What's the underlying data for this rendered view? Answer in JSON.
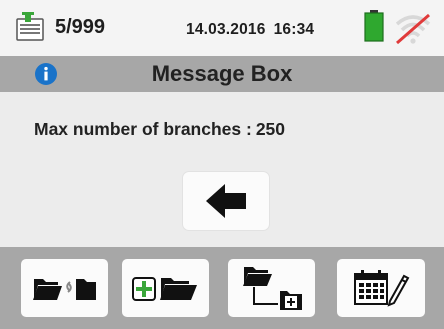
{
  "status": {
    "memory_count": "5/999",
    "date": "14.03.2016",
    "time": "16:34",
    "battery_color": "#2fa82f",
    "wifi_disabled_color": "#e03a3a"
  },
  "dialog": {
    "title": "Message Box",
    "message_label": "Max number of branches :",
    "message_value": "250"
  },
  "icons": {
    "memory": "memory-card-icon",
    "battery": "battery-icon",
    "wifi": "wifi-off-icon",
    "info": "info-icon",
    "back": "back-arrow-icon",
    "softkeys": [
      "move-folder-icon",
      "add-folder-icon",
      "add-subfolder-icon",
      "calendar-edit-icon"
    ]
  },
  "colors": {
    "title_bar": "#a7a7a7",
    "info_blue": "#1a73c9",
    "accent_green": "#3aa63a"
  }
}
